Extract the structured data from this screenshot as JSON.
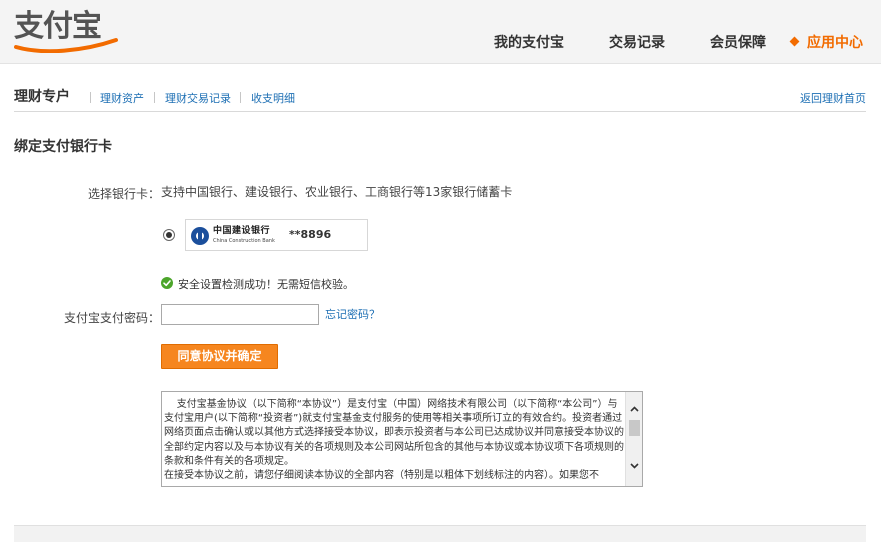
{
  "header": {
    "logo": "支付宝",
    "nav": [
      "我的支付宝",
      "交易记录",
      "会员保障",
      "应用中心"
    ]
  },
  "subnav": {
    "title": "理财专户",
    "links": [
      "理财资产",
      "理财交易记录",
      "收支明细"
    ],
    "back": "返回理财首页"
  },
  "page_title": "绑定支付银行卡",
  "form": {
    "bank_label": "选择银行卡：",
    "bank_desc": "支持中国银行、建设银行、农业银行、工商银行等13家银行储蓄卡",
    "bank_name_cn": "中国建设银行",
    "bank_name_en": "China Construction Bank",
    "card_number": "**8896",
    "check_msg": "安全设置检测成功！无需短信校验。",
    "pwd_label": "支付宝支付密码：",
    "pwd_value": "",
    "forgot": "忘记密码？",
    "agree_button": "同意协议并确定"
  },
  "agreement": {
    "text": "    支付宝基金协议（以下简称“本协议”）是支付宝（中国）网络技术有限公司（以下简称“本公司”）与支付宝用户(以下简称“投资者”)就支付宝基金支付服务的使用等相关事项所订立的有效合约。投资者通过网络页面点击确认或以其他方式选择接受本协议，即表示投资者与本公司已达成协议并同意接受本协议的全部约定内容以及与本协议有关的各项规则及本公司网站所包含的其他与本协议或本协议项下各项规则的条款和条件有关的各项规定。\n在接受本协议之前，请您仔细阅读本协议的全部内容（特别是以粗体下划线标注的内容）。如果您不"
  },
  "colors": {
    "accent": "#f26b00",
    "link": "#1d6fb4",
    "button": "#f6861f",
    "success": "#4ca52b"
  }
}
